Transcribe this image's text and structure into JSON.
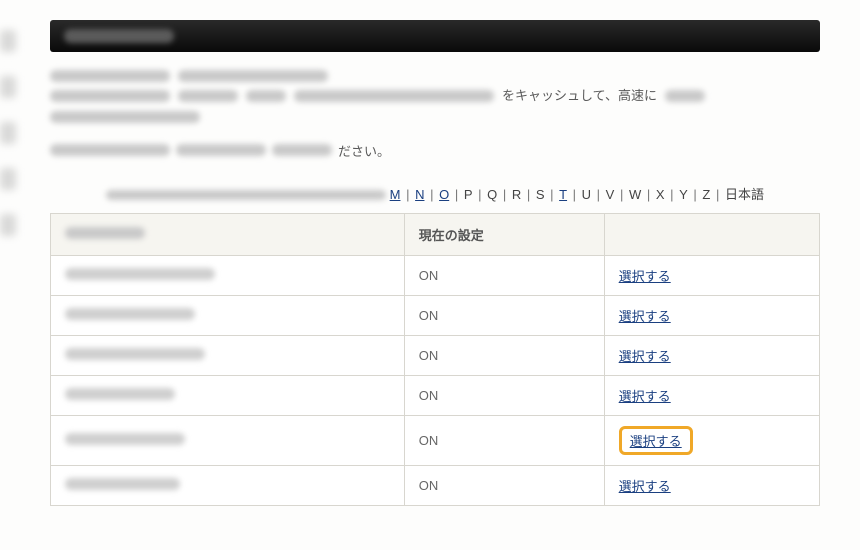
{
  "titleBar": {
    "placeholder": "●●●●●設定"
  },
  "description": {
    "visibleFragment1": "をキャッシュして、高速に",
    "endText": "ださい。"
  },
  "alphaNav": {
    "links": [
      "M",
      "N",
      "O",
      "T"
    ],
    "static": [
      "P",
      "Q",
      "R",
      "S",
      "U",
      "V",
      "W",
      "X",
      "Y",
      "Z",
      "日本語"
    ]
  },
  "table": {
    "headers": {
      "domain": "",
      "status": "現在の設定",
      "action": ""
    },
    "rows": [
      {
        "domainWidth": 150,
        "status": "ON",
        "action": "選択する",
        "highlight": false
      },
      {
        "domainWidth": 130,
        "status": "ON",
        "action": "選択する",
        "highlight": false
      },
      {
        "domainWidth": 140,
        "status": "ON",
        "action": "選択する",
        "highlight": false
      },
      {
        "domainWidth": 110,
        "status": "ON",
        "action": "選択する",
        "highlight": false
      },
      {
        "domainWidth": 120,
        "status": "ON",
        "action": "選択する",
        "highlight": true
      },
      {
        "domainWidth": 115,
        "status": "ON",
        "action": "選択する",
        "highlight": false
      }
    ]
  }
}
